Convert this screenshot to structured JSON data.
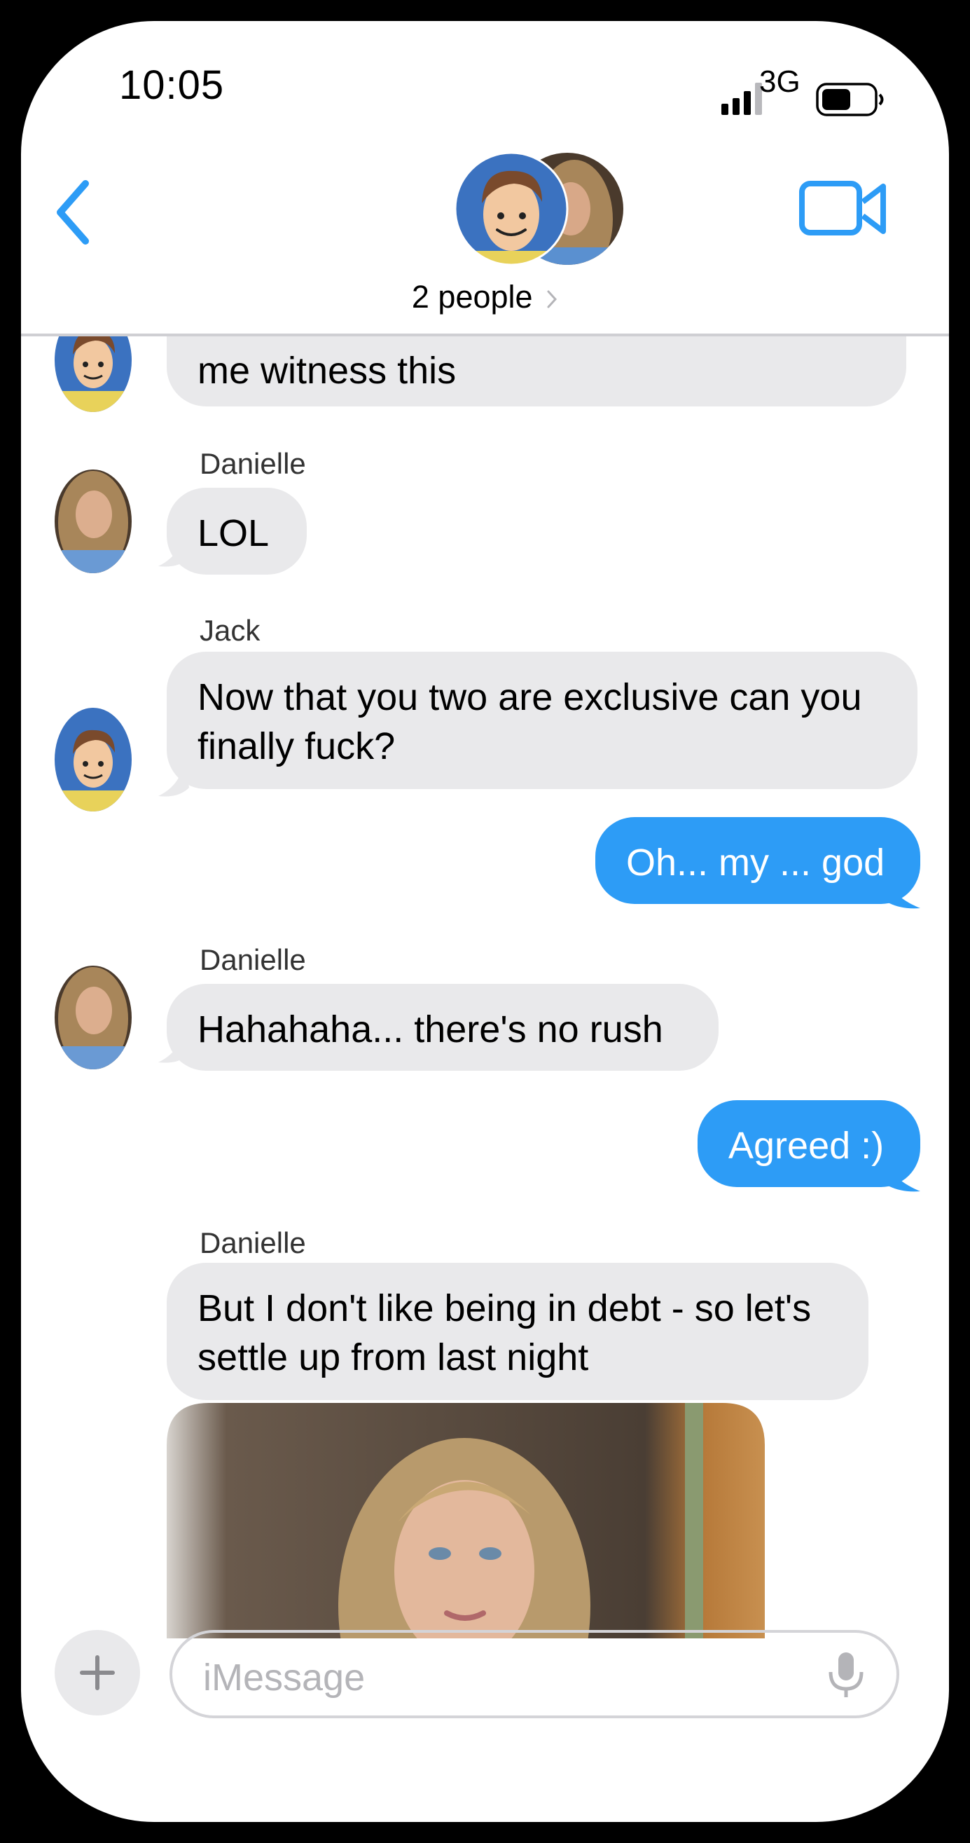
{
  "status_bar": {
    "time": "10:05",
    "network": "3G"
  },
  "header": {
    "title": "2 people"
  },
  "colors": {
    "accent": "#2d9cf6",
    "received_bubble": "#e9e9eb"
  },
  "messages": [
    {
      "type": "received",
      "sender": "Jack",
      "text": "me witness this"
    },
    {
      "type": "received",
      "sender": "Danielle",
      "text": "LOL"
    },
    {
      "type": "received",
      "sender": "Jack",
      "lines": [
        "Now that you two are exclusive can you",
        "finally fuck?"
      ]
    },
    {
      "type": "sent",
      "text": "Oh... my ... god"
    },
    {
      "type": "received",
      "sender": "Danielle",
      "text": "Hahahaha...  there's no rush"
    },
    {
      "type": "sent",
      "text": "Agreed :)"
    },
    {
      "type": "received",
      "sender": "Danielle",
      "lines": [
        "But I don't like being in debt - so let's",
        "settle up from last night"
      ]
    },
    {
      "type": "received-photo",
      "sender": "Danielle"
    }
  ],
  "input": {
    "placeholder": "iMessage"
  },
  "icons": {
    "back": "chevron-left-icon",
    "video": "video-camera-icon",
    "add": "plus-icon",
    "mic": "microphone-icon",
    "signal": "cellular-signal-icon",
    "battery": "battery-icon"
  }
}
